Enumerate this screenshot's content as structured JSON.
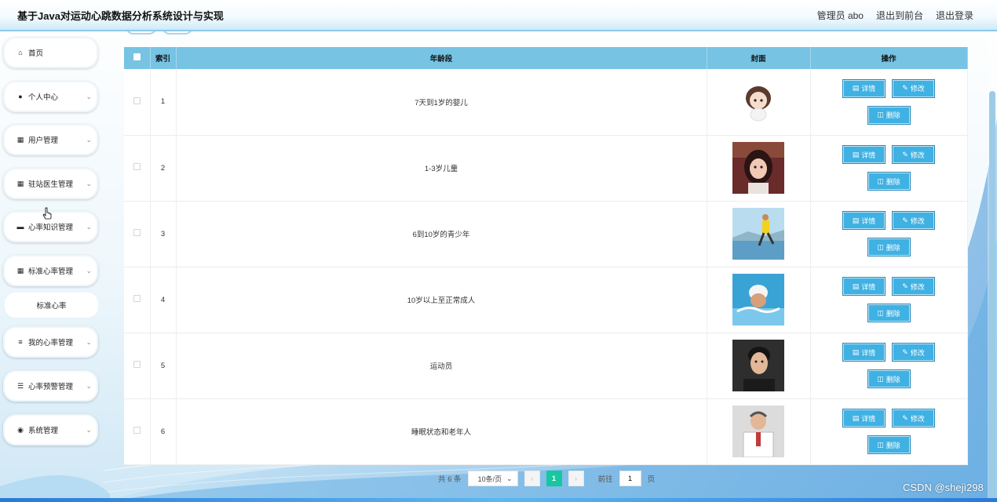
{
  "header": {
    "title": "基于Java对运动心跳数据分析系统设计与实现",
    "admin_label": "管理员 abo",
    "front_label": "退出到前台",
    "logout_label": "退出登录"
  },
  "sidebar": {
    "items": [
      {
        "label": "首页",
        "icon": "home-icon"
      },
      {
        "label": "个人中心",
        "icon": "user-icon"
      },
      {
        "label": "用户管理",
        "icon": "grid-icon"
      },
      {
        "label": "驻站医生管理",
        "icon": "grid-icon"
      },
      {
        "label": "心率知识管理",
        "icon": "monitor-icon"
      },
      {
        "label": "标准心率管理",
        "icon": "grid-icon"
      },
      {
        "label": "我的心率管理",
        "icon": "sliders-icon"
      },
      {
        "label": "心率预警管理",
        "icon": "list-icon"
      },
      {
        "label": "系统管理",
        "icon": "pin-icon"
      }
    ],
    "sub_item": "标准心率"
  },
  "table": {
    "headers": {
      "index": "索引",
      "age_group": "年龄段",
      "cover": "封面",
      "actions": "操作"
    },
    "rows": [
      {
        "index": "1",
        "age_group": "7天到1岁的婴儿"
      },
      {
        "index": "2",
        "age_group": "1-3岁儿童"
      },
      {
        "index": "3",
        "age_group": "6到10岁的青少年"
      },
      {
        "index": "4",
        "age_group": "10岁以上至正常成人"
      },
      {
        "index": "5",
        "age_group": "运动员"
      },
      {
        "index": "6",
        "age_group": "睡眠状态和老年人"
      }
    ],
    "actions": {
      "detail": "详情",
      "edit": "修改",
      "delete": "删除"
    }
  },
  "pagination": {
    "total": "共 6 条",
    "page_size": "10条/页",
    "current_page": "1",
    "goto_label": "前往",
    "goto_value": "1",
    "page_suffix": "页"
  },
  "watermark": "CSDN @shejì298"
}
